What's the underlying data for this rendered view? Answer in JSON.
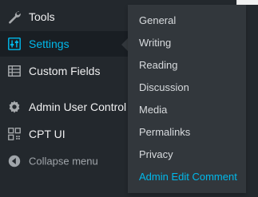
{
  "admin_menu": {
    "items": [
      {
        "label": "Tools",
        "icon": "wrench-icon"
      },
      {
        "label": "Settings",
        "icon": "settings-sliders-icon"
      },
      {
        "label": "Custom Fields",
        "icon": "custom-fields-grid-icon"
      },
      {
        "label": "Admin User Control",
        "icon": "gear-icon"
      },
      {
        "label": "CPT UI",
        "icon": "cpt-ui-grid-icon"
      },
      {
        "label": "Collapse menu",
        "icon": "collapse-arrow-icon"
      }
    ],
    "current": "Settings"
  },
  "settings_submenu": {
    "items": [
      {
        "label": "General"
      },
      {
        "label": "Writing"
      },
      {
        "label": "Reading"
      },
      {
        "label": "Discussion"
      },
      {
        "label": "Media"
      },
      {
        "label": "Permalinks"
      },
      {
        "label": "Privacy"
      },
      {
        "label": "Admin Edit Comment"
      }
    ],
    "highlighted": "Admin Edit Comment"
  },
  "colors": {
    "menu_background": "#23282d",
    "submenu_background": "#32373c",
    "accent": "#00b9eb",
    "text": "#f0f0f1",
    "muted_text": "#a0a5aa"
  }
}
